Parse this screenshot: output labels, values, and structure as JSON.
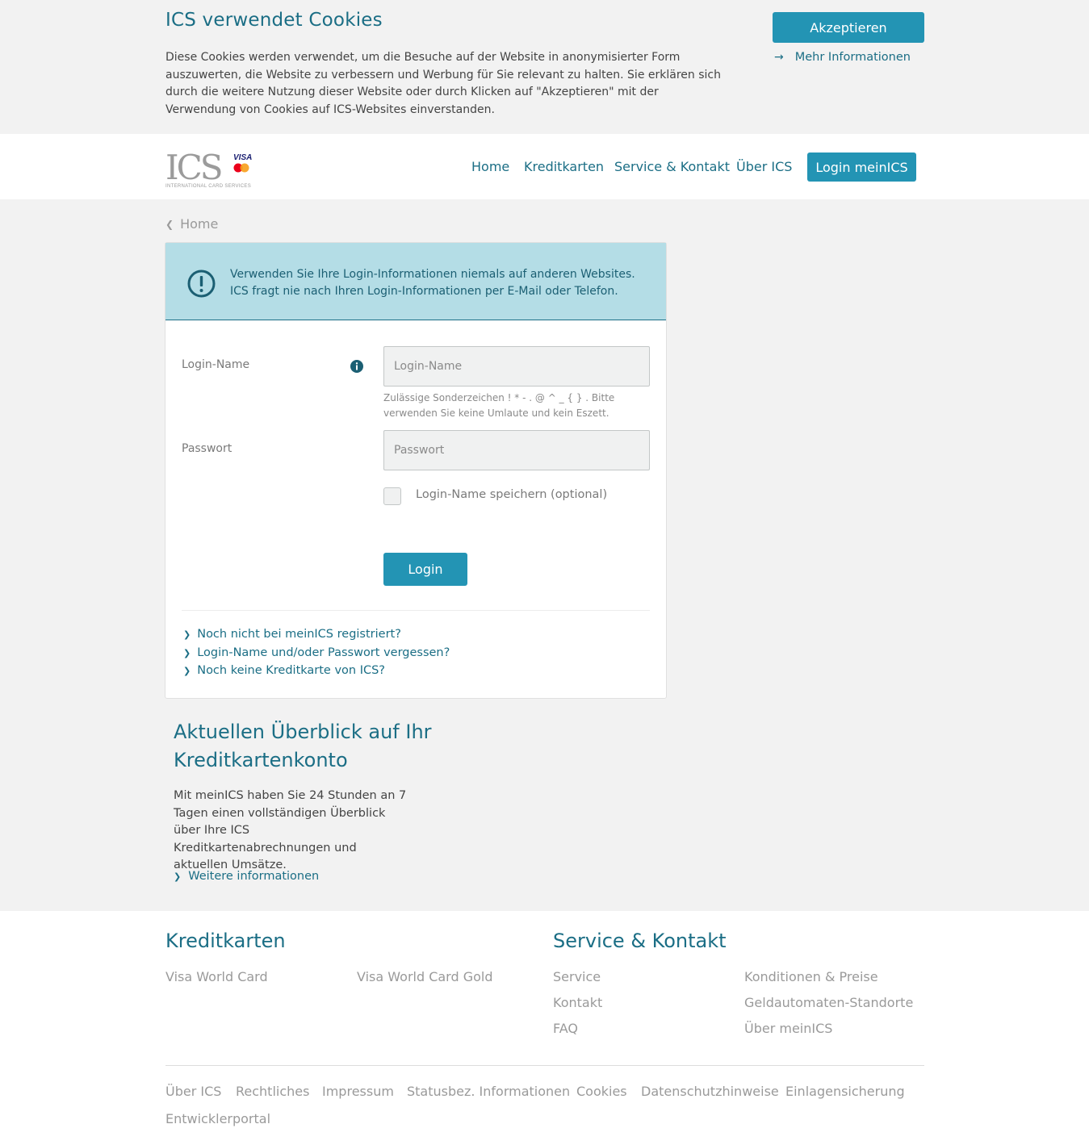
{
  "cookie": {
    "title": "ICS verwendet Cookies",
    "text": "Diese Cookies werden verwendet, um die Besuche auf der Website in anonymisierter Form auszuwerten, die Website zu verbessern und Werbung für Sie relevant zu halten. Sie erklären sich durch die weitere Nutzung dieser Website oder durch Klicken auf \"Akzeptieren\" mit der Verwendung von Cookies auf ICS-Websites einverstanden.",
    "accept_label": "Akzeptieren",
    "more_info_label": "Mehr Informationen"
  },
  "header": {
    "logo": {
      "brand": "ICS",
      "tagline": "INTERNATIONAL CARD SERVICES",
      "visa": "VISA"
    },
    "nav": [
      "Home",
      "Kreditkarten",
      "Service & Kontakt",
      "Über ICS"
    ],
    "login_button": "Login meinICS"
  },
  "breadcrumb": {
    "label": "Home"
  },
  "alert": {
    "text": "Verwenden Sie Ihre Login-Informationen niemals auf anderen Websites. ICS fragt nie nach Ihren Login-Informationen per E-Mail oder Telefon."
  },
  "form": {
    "login_name_label": "Login-Name",
    "login_name_placeholder": "Login-Name",
    "login_name_hint": "Zulässige Sonderzeichen ! * - . @ ^ _ { } . Bitte verwenden Sie keine Umlaute und kein Eszett.",
    "password_label": "Passwort",
    "password_placeholder": "Passwort",
    "remember_label": "Login-Name speichern (optional)",
    "remember_checked": false,
    "submit_label": "Login"
  },
  "card_links": [
    "Noch nicht bei meinICS registriert?",
    "Login-Name und/oder Passwort vergessen?",
    "Noch keine Kreditkarte von ICS?"
  ],
  "overview": {
    "title": "Aktuellen Überblick auf Ihr Kreditkartenkonto",
    "text": "Mit meinICS haben Sie 24 Stunden an 7 Tagen einen vollständigen Überblick über Ihre ICS Kreditkartenabrechnungen und aktuellen Umsätze.",
    "link": "Weitere informationen"
  },
  "footer": {
    "kreditkarten": {
      "heading": "Kreditkarten",
      "links": [
        "Visa World Card",
        "Visa World Card Gold"
      ]
    },
    "service": {
      "heading": "Service & Kontakt",
      "links": [
        "Service",
        "Konditionen & Preise",
        "Kontakt",
        "Geldautomaten-Standorte",
        "FAQ",
        "Über meinICS"
      ]
    },
    "bottom_links": [
      "Über ICS",
      "Rechtliches",
      "Impressum",
      "Statusbez. Informationen",
      "Cookies",
      "Datenschutzhinweise",
      "Einlagensicherung",
      "Entwicklerportal"
    ]
  },
  "colors": {
    "accent": "#2394b4",
    "brand_text": "#1b6e85",
    "alert_bg": "#b4dde6"
  },
  "icons": {
    "arrow": "arrow-right-icon",
    "chevron": "chevron-right-icon",
    "alert": "exclamation-circle-icon",
    "info": "info-icon"
  }
}
